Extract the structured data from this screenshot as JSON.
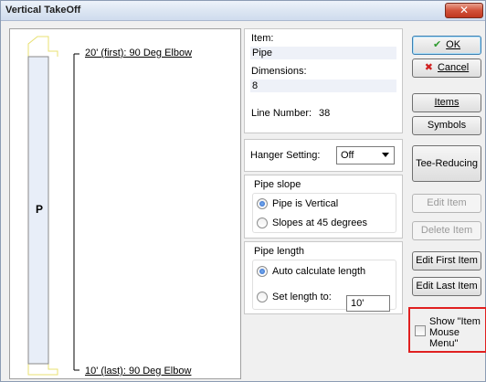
{
  "window": {
    "title": "Vertical TakeOff",
    "close_glyph": "✕"
  },
  "drawing": {
    "pipe_letter": "P",
    "top_label": "20' (first): 90 Deg Elbow",
    "bottom_label": "10' (last): 90 Deg Elbow",
    "pipe_fill": "#e8eef8",
    "elbow_color": "#e8e070"
  },
  "info": {
    "item_label": "Item:",
    "item_value": "Pipe",
    "dimensions_label": "Dimensions:",
    "dimensions_value": "8",
    "line_number_label": "Line Number:",
    "line_number_value": "38"
  },
  "hanger": {
    "label": "Hanger Setting:",
    "value": "Off"
  },
  "pipe_slope": {
    "title": "Pipe slope",
    "options": [
      {
        "label": "Pipe is Vertical",
        "selected": true
      },
      {
        "label": "Slopes at 45 degrees",
        "selected": false
      }
    ]
  },
  "pipe_length": {
    "title": "Pipe length",
    "options": [
      {
        "label": "Auto calculate length",
        "selected": true
      },
      {
        "label": "Set length to:",
        "selected": false
      }
    ],
    "set_length_value": "10'"
  },
  "buttons": {
    "ok": {
      "icon": "checkmark-icon",
      "label": "OK"
    },
    "cancel": {
      "icon": "x-icon",
      "label": "Cancel"
    },
    "items": "Items",
    "symbols": "Symbols",
    "tee_reducing": "Tee-Reducing",
    "edit_item": "Edit Item",
    "delete_item": "Delete Item",
    "edit_first_item": "Edit First Item",
    "edit_last_item": "Edit Last Item"
  },
  "show_menu": {
    "label": "Show \"Item Mouse Menu\"",
    "checked": false,
    "highlight_color": "#e02020"
  }
}
